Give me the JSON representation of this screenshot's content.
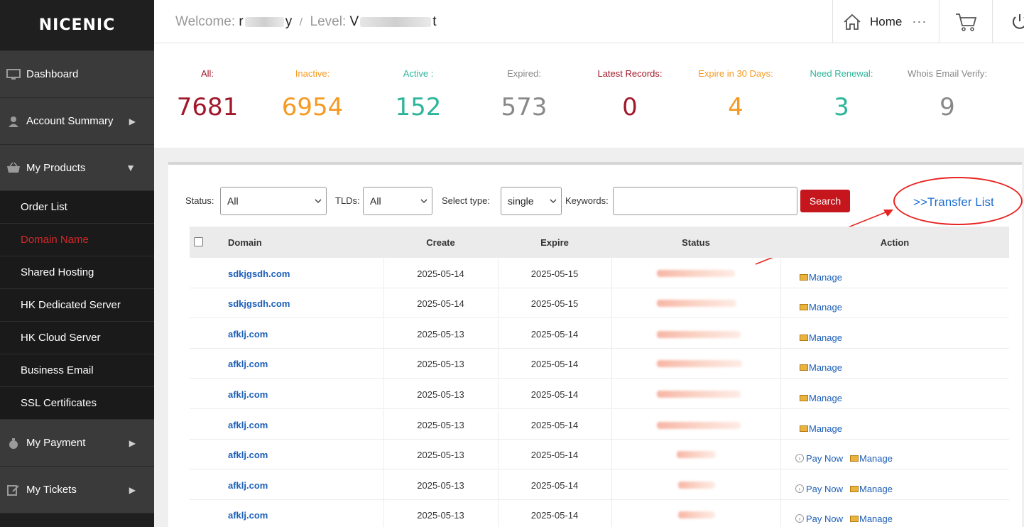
{
  "sidebar": {
    "logo": "NICENIC",
    "main_items": [
      {
        "label": "Dashboard",
        "icon": "monitor-icon"
      },
      {
        "label": "Account Summary",
        "icon": "user-icon"
      },
      {
        "label": "My Products",
        "icon": "basket-icon"
      },
      {
        "label": "My Payment",
        "icon": "money-bag-icon"
      },
      {
        "label": "My Tickets",
        "icon": "edit-icon"
      }
    ],
    "sub_items": [
      "Order List",
      "Domain Name",
      "Shared Hosting",
      "HK Dedicated Server",
      "HK Cloud Server",
      "Business Email",
      "SSL Certificates"
    ]
  },
  "header": {
    "welcome_label": "Welcome:",
    "welcome_value_start": "r",
    "welcome_value_end": "y",
    "separator": "/",
    "level_label": "Level:",
    "level_value_start": "V",
    "level_value_end": "t",
    "home_label": "Home",
    "more": "···"
  },
  "stats": [
    {
      "label": "All:",
      "value": "7681",
      "color": "#a0182a"
    },
    {
      "label": "Inactive:",
      "value": "6954",
      "color": "#f59a23"
    },
    {
      "label": "Active :",
      "value": "152",
      "color": "#2bb59a"
    },
    {
      "label": "Expired:",
      "value": "573",
      "color": "#888888"
    },
    {
      "label": "Latest Records:",
      "value": "0",
      "color": "#a0182a"
    },
    {
      "label": "Expire in 30 Days:",
      "value": "4",
      "color": "#f59a23"
    },
    {
      "label": "Need Renewal:",
      "value": "3",
      "color": "#2bb59a"
    },
    {
      "label": "Whois Email Verify:",
      "value": "9",
      "color": "#888888"
    }
  ],
  "filters": {
    "status_label": "Status:",
    "status_value": "All",
    "tlds_label": "TLDs:",
    "tlds_value": "All",
    "select_type_label": "Select type:",
    "select_type_value": "single",
    "keywords_label": "Keywords:",
    "keywords_value": "",
    "search_label": "Search",
    "transfer_label": ">>Transfer List"
  },
  "table": {
    "headers": {
      "domain": "Domain",
      "create": "Create",
      "expire": "Expire",
      "status": "Status",
      "action": "Action"
    },
    "rows": [
      {
        "domain": "sdkjgsdh.com",
        "create": "2025-05-14",
        "expire": "2025-05-15",
        "actions": [
          "Manage"
        ]
      },
      {
        "domain": "sdkjgsdh.com",
        "create": "2025-05-14",
        "expire": "2025-05-15",
        "actions": [
          "Manage"
        ]
      },
      {
        "domain": "afklj.com",
        "create": "2025-05-13",
        "expire": "2025-05-14",
        "actions": [
          "Manage"
        ]
      },
      {
        "domain": "afklj.com",
        "create": "2025-05-13",
        "expire": "2025-05-14",
        "actions": [
          "Manage"
        ]
      },
      {
        "domain": "afklj.com",
        "create": "2025-05-13",
        "expire": "2025-05-14",
        "actions": [
          "Manage"
        ]
      },
      {
        "domain": "afklj.com",
        "create": "2025-05-13",
        "expire": "2025-05-14",
        "actions": [
          "Manage"
        ]
      },
      {
        "domain": "afklj.com",
        "create": "2025-05-13",
        "expire": "2025-05-14",
        "actions": [
          "Pay Now",
          "Manage"
        ]
      },
      {
        "domain": "afklj.com",
        "create": "2025-05-13",
        "expire": "2025-05-14",
        "actions": [
          "Pay Now",
          "Manage"
        ]
      },
      {
        "domain": "afklj.com",
        "create": "2025-05-13",
        "expire": "2025-05-14",
        "actions": [
          "Pay Now",
          "Manage"
        ]
      }
    ]
  },
  "colors": {
    "accent_red": "#c4161c",
    "link_blue": "#1d5fb8",
    "sidebar_bg": "#1f1f1f"
  }
}
